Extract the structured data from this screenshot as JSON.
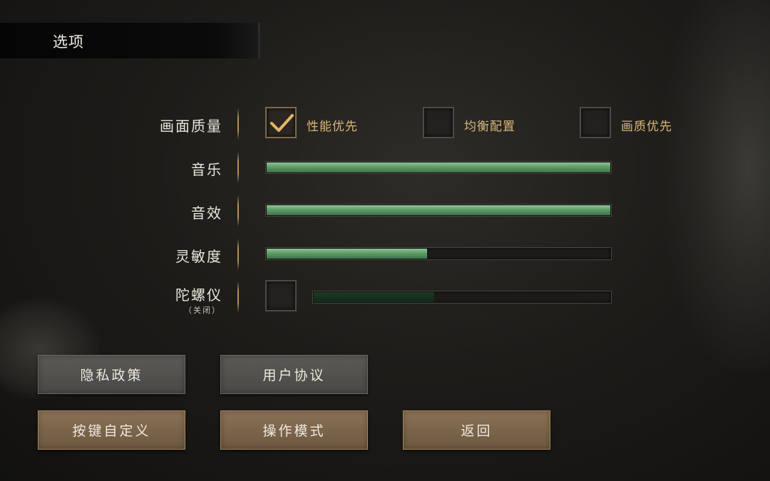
{
  "header": {
    "title": "选项"
  },
  "settings": {
    "graphics": {
      "label": "画面质量",
      "options": [
        {
          "label": "性能优先",
          "checked": true
        },
        {
          "label": "均衡配置",
          "checked": false
        },
        {
          "label": "画质优先",
          "checked": false
        }
      ]
    },
    "music": {
      "label": "音乐",
      "level": 1.0
    },
    "sfx": {
      "label": "音效",
      "level": 1.0
    },
    "sensitivity": {
      "label": "灵敏度",
      "level": 0.47
    },
    "gyro": {
      "label": "陀螺仪",
      "status": "（关闭）",
      "enabled": false,
      "level": 0.41
    }
  },
  "buttons": {
    "privacy": "隐私政策",
    "agreement": "用户协议",
    "keybind": "按键自定义",
    "mode": "操作模式",
    "back": "返回"
  },
  "colors": {
    "accent_gold": "#d8b679",
    "slider_green": "#6aa874",
    "button_brown": "#7d6549"
  }
}
